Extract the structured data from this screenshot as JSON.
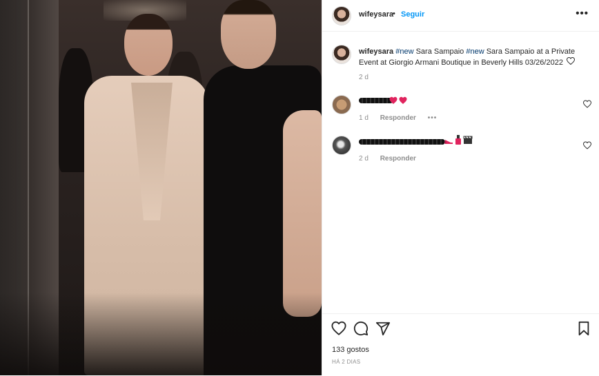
{
  "post": {
    "username": "wifeysara",
    "separator": "•",
    "follow_label": "Seguir",
    "more_label": "•••"
  },
  "caption": {
    "username": "wifeysara",
    "hashtag1": "#new",
    "text1": " Sara Sampaio ",
    "hashtag2": "#new",
    "text2": " Sara Sampaio at a Private Event at Giorgio Armani Boutique in Beverly Hills 03/26/2022",
    "time": "2 d"
  },
  "comments": [
    {
      "time": "1 d",
      "reply_label": "Responder",
      "more_label": "•••",
      "emojis": [
        "heart-emoji",
        "heart-emoji"
      ]
    },
    {
      "time": "2 d",
      "reply_label": "Responder",
      "emojis": [
        "high-heel-emoji",
        "nail-polish-emoji",
        "clapper-board-emoji"
      ]
    }
  ],
  "actions": {
    "icons": [
      "heart-icon",
      "comment-icon",
      "share-icon",
      "bookmark-icon"
    ],
    "likes": "133 gostos",
    "posted": "HÁ 2 DIAS"
  },
  "colors": {
    "link_blue": "#0095f6",
    "hashtag_blue": "#00376b",
    "muted_gray": "#8e8e8e",
    "emoji_red": "#e0245e"
  }
}
